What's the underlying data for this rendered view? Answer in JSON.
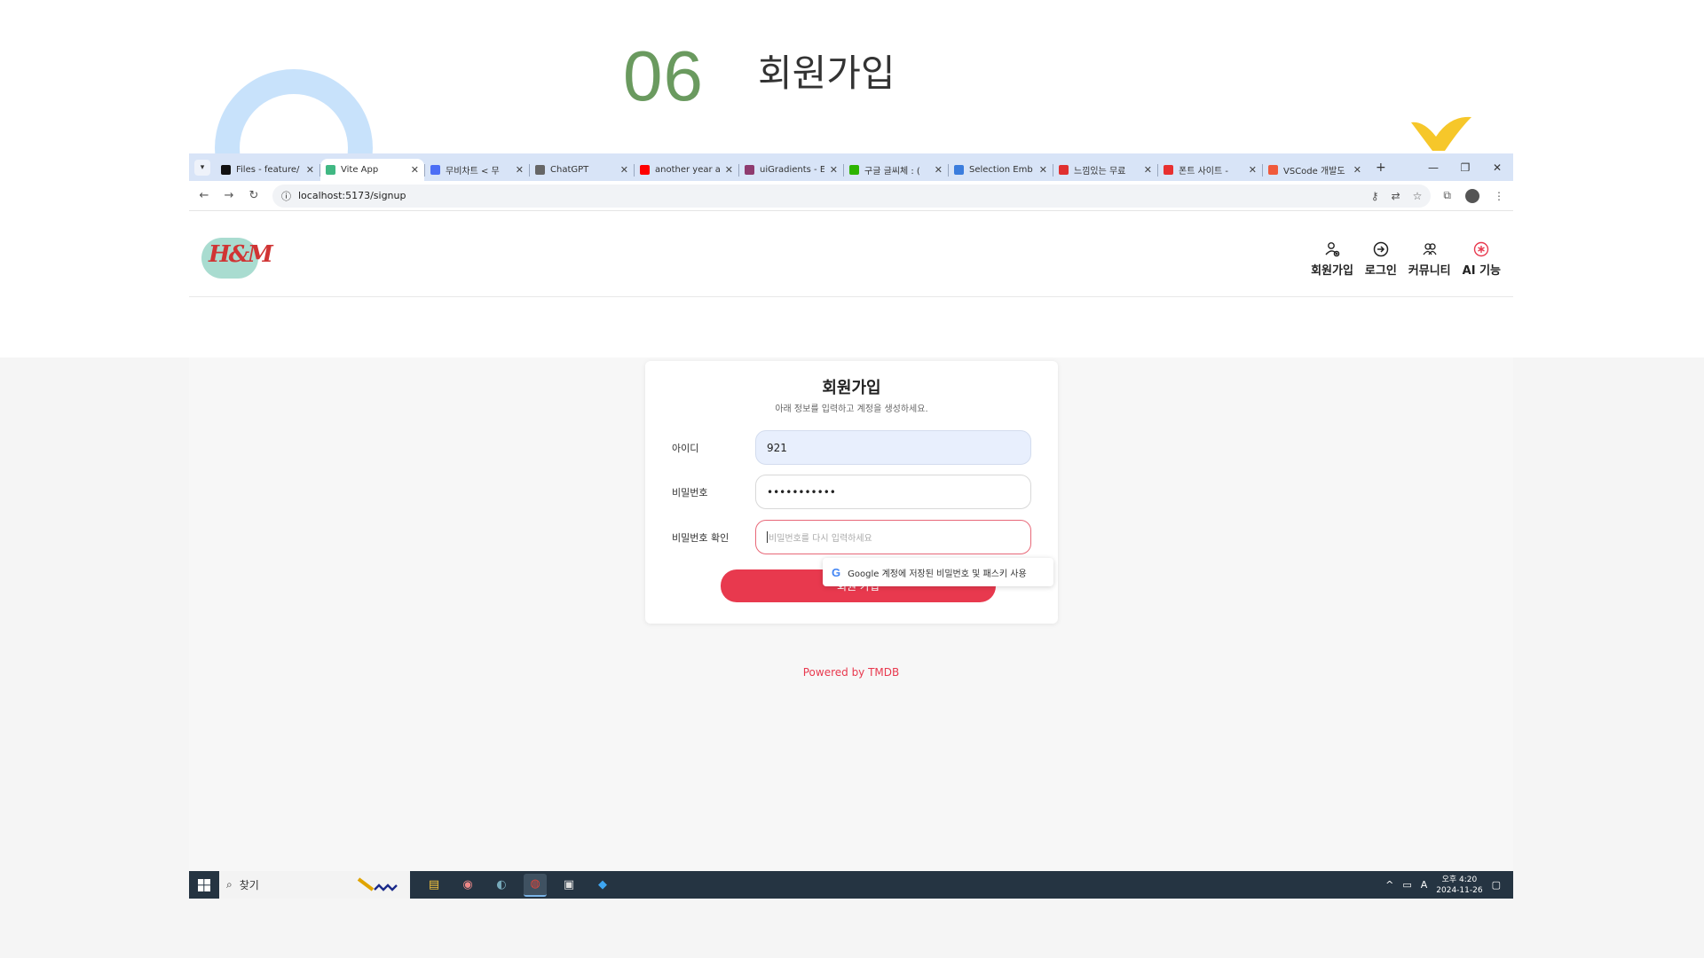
{
  "slide": {
    "number": "06",
    "title": "회원가입"
  },
  "browser": {
    "tabs": [
      {
        "label": "Files - feature/",
        "color": "#111111",
        "active": false
      },
      {
        "label": "Vite App",
        "color": "#41b883",
        "active": true
      },
      {
        "label": "무비차트 < 무",
        "color": "#4c6ef5",
        "active": false
      },
      {
        "label": "ChatGPT",
        "color": "#666666",
        "active": false
      },
      {
        "label": "another year a",
        "color": "#ff0000",
        "active": false
      },
      {
        "label": "uiGradients - E",
        "color": "#8e3b6f",
        "active": false
      },
      {
        "label": "구글 글씨체 : (",
        "color": "#2db400",
        "active": false
      },
      {
        "label": "Selection Emb",
        "color": "#3b7ddd",
        "active": false
      },
      {
        "label": "느낌있는 무료",
        "color": "#e03030",
        "active": false
      },
      {
        "label": "폰트 사이트 -",
        "color": "#e83030",
        "active": false
      },
      {
        "label": "VSCode 개발도",
        "color": "#f05a3c",
        "active": false
      }
    ],
    "url": "localhost:5173/signup"
  },
  "header": {
    "logo_text": "H&M",
    "nav": [
      {
        "label": "회원가입",
        "icon": "user-add-icon"
      },
      {
        "label": "로그인",
        "icon": "login-icon"
      },
      {
        "label": "커뮤니티",
        "icon": "community-icon"
      },
      {
        "label": "AI 기능",
        "icon": "ai-icon"
      }
    ]
  },
  "form": {
    "title": "회원가입",
    "subtitle": "아래 정보를 입력하고 계정을 생성하세요.",
    "id_label": "아이디",
    "id_value": "921",
    "password_label": "비밀번호",
    "password_value": "•••••••••••",
    "confirm_label": "비밀번호 확인",
    "confirm_placeholder": "비밀번호를 다시 입력하세요",
    "submit_label": "회원 가입",
    "google_popup": "Google 계정에 저장된 비밀번호 및 패스키 사용"
  },
  "footer": {
    "powered": "Powered by TMDB"
  },
  "taskbar": {
    "search_label": "찾기",
    "clock_time": "오후 4:20",
    "clock_date": "2024-11-26",
    "tray_lang": "A"
  },
  "colors": {
    "accent": "#e8394e",
    "slide_number": "#6a9a5f",
    "tabstrip": "#d8e4f7"
  }
}
